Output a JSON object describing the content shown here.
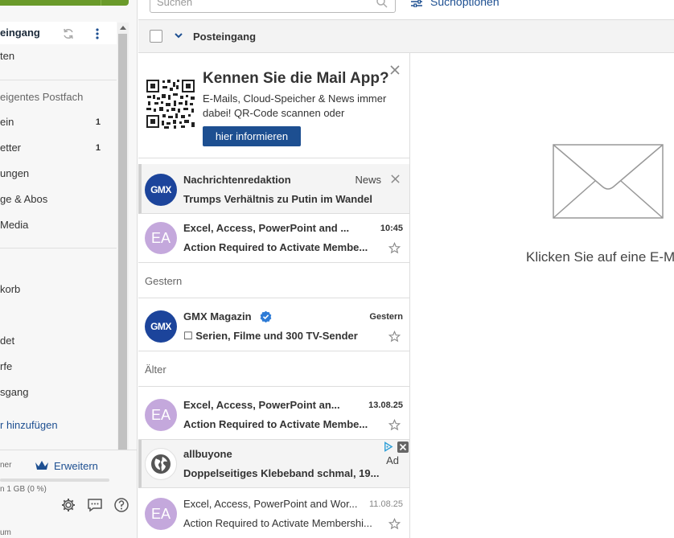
{
  "sidebar": {
    "folders": [
      {
        "label": "eingang",
        "count": ""
      },
      {
        "label": "ten",
        "count": ""
      },
      {
        "label": "eigentes Postfach",
        "count": ""
      },
      {
        "label": "ein",
        "count": "1"
      },
      {
        "label": "etter",
        "count": "1"
      },
      {
        "label": "ungen",
        "count": ""
      },
      {
        "label": "ge & Abos",
        "count": ""
      },
      {
        "label": " Media",
        "count": ""
      },
      {
        "label": "korb",
        "count": ""
      },
      {
        "label": "det",
        "count": ""
      },
      {
        "label": "rfe",
        "count": ""
      },
      {
        "label": "sgang",
        "count": ""
      }
    ],
    "add_folder": "r hinzufügen",
    "storage_label": "ner",
    "upgrade": "Erweitern",
    "storage_text": "n 1 GB (0 %)",
    "storage_fraction": 0.0,
    "footer_text": "um"
  },
  "search": {
    "placeholder": "Suchen"
  },
  "search_options": "Suchoptionen",
  "list_header": {
    "title": "Posteingang"
  },
  "ad_box": {
    "title": "Kennen Sie die Mail App?",
    "text": "E-Mails, Cloud-Speicher & News immer dabei! QR-Code scannen oder",
    "button": "hier informieren"
  },
  "messages": [
    {
      "avatar": "GMX",
      "sender": "Nachrichtenredaktion",
      "meta": "News",
      "subject": "Trumps Verhältnis zu Putin im Wandel"
    },
    {
      "avatar": "EA",
      "sender": "Excel, Access, PowerPoint and ...",
      "meta": "10:45",
      "subject": "Action Required to Activate Membe..."
    },
    {
      "group": "Gestern"
    },
    {
      "avatar": "GMX",
      "sender": "GMX Magazin",
      "meta": "Gestern",
      "subject": "☐ Serien, Filme und 300 TV-Sender"
    },
    {
      "group": "Älter"
    },
    {
      "avatar": "EA",
      "sender": "Excel, Access, PowerPoint an...",
      "meta": "13.08.25",
      "subject": "Action Required to Activate Membe..."
    },
    {
      "avatar": "",
      "sender": "allbuyone",
      "meta": "Ad",
      "subject": "Doppelseitiges Klebeband schmal, 19..."
    },
    {
      "avatar": "EA",
      "sender": "Excel, Access, PowerPoint and Wor...",
      "meta": "11.08.25",
      "subject": "Action Required to Activate Membershi..."
    }
  ],
  "reading_pane": {
    "empty_text": "Klicken Sie auf eine E-Mail"
  },
  "colors": {
    "accent": "#1d4f91",
    "brand_green": "#6a9a2a",
    "gmx_blue": "#1c449b",
    "avatar_purple": "#c4a8dc"
  },
  "icons": [
    "sync-icon",
    "kebab-icon",
    "search-icon",
    "filter-icon",
    "chevron-down-icon",
    "close-icon",
    "star-icon",
    "verified-icon",
    "globe-icon",
    "adchoices-icon",
    "crown-icon",
    "gear-icon",
    "chat-icon",
    "help-icon",
    "envelope-icon"
  ]
}
